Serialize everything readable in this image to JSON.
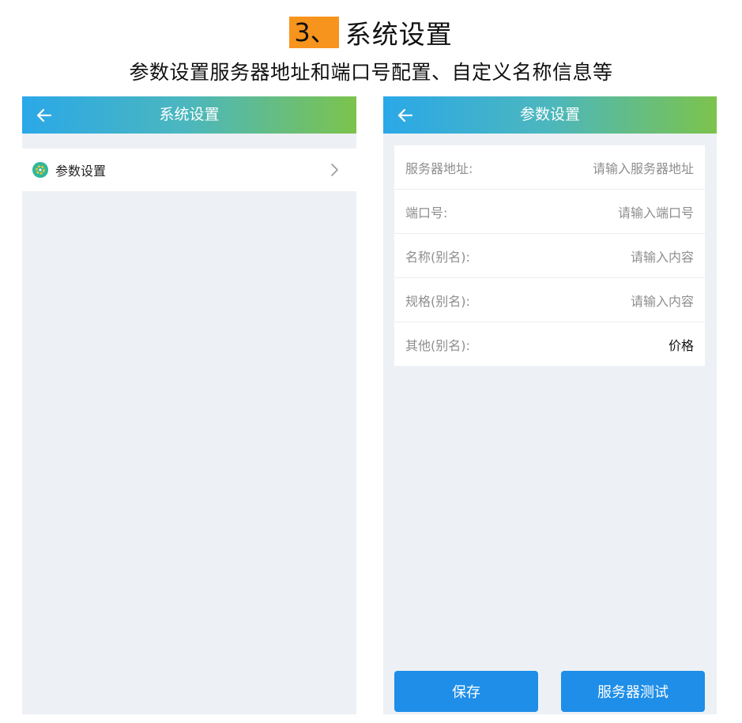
{
  "heading": {
    "step": "3、",
    "title": "系统设置"
  },
  "subtitle": "参数设置服务器地址和端口号配置、自定义名称信息等",
  "left_screen": {
    "topbar_title": "系统设置",
    "menu": [
      {
        "label": "参数设置",
        "icon": "settings-gear-icon"
      }
    ]
  },
  "right_screen": {
    "topbar_title": "参数设置",
    "fields": [
      {
        "label": "服务器地址:",
        "placeholder": "请输入服务器地址",
        "value": ""
      },
      {
        "label": "端口号:",
        "placeholder": "请输入端口号",
        "value": ""
      },
      {
        "label": "名称(别名):",
        "placeholder": "请输入内容",
        "value": ""
      },
      {
        "label": "规格(别名):",
        "placeholder": "请输入内容",
        "value": ""
      },
      {
        "label": "其他(别名):",
        "placeholder": "",
        "value": "价格"
      }
    ],
    "buttons": {
      "save": "保存",
      "test": "服务器测试"
    }
  },
  "colors": {
    "accent_orange": "#f7941d",
    "topbar_gradient_start": "#2aa8e8",
    "topbar_gradient_end": "#7cc34c",
    "button_blue": "#1e8ee8",
    "background": "#edf1f5"
  }
}
